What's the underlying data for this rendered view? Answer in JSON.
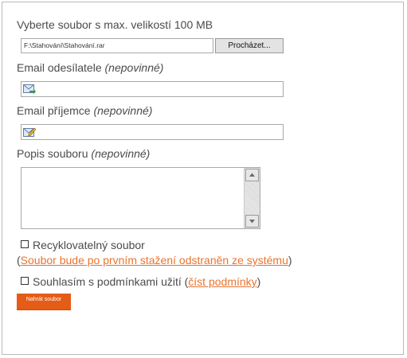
{
  "form": {
    "file_label": "Vyberte soubor s max. velikostí 100 MB",
    "file_value": "F:\\Stahování\\Stahování.rar",
    "browse_label": "Procházet...",
    "sender_label": "Email odesílatele",
    "sender_optional": "(nepovinné)",
    "sender_value": "",
    "recipient_label": "Email příjemce",
    "recipient_optional": "(nepovinné)",
    "recipient_value": "",
    "description_label": "Popis souboru",
    "description_optional": "(nepovinné)",
    "description_value": "",
    "recyclable_label": "Recyklovatelný soubor",
    "recyclable_note_open": "(",
    "recyclable_note_link": "Soubor bude po prvním stažení odstraněn ze systému",
    "recyclable_note_close": ")",
    "agree_label": "Souhlasím s podmínkami užití (",
    "agree_link": "číst podmínky",
    "agree_close": ")",
    "upload_label": "Nahrát soubor"
  },
  "colors": {
    "accent": "#e55c17",
    "link": "#e8742f"
  },
  "icons": {
    "sender": "envelope-arrow-icon",
    "recipient": "envelope-pencil-icon"
  }
}
